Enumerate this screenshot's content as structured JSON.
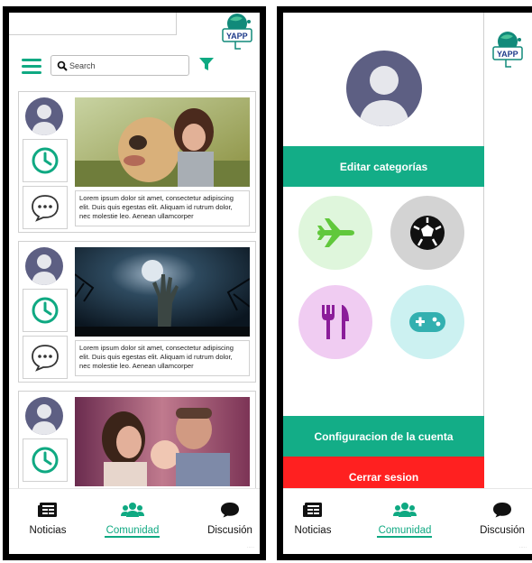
{
  "colors": {
    "accent": "#0fa982",
    "drawer_green": "#13ad87",
    "danger": "#ff2020",
    "avatar_bg": "#5d5f83"
  },
  "left_screen": {
    "search": {
      "placeholder": "Search"
    },
    "posts": [
      {
        "caption": "Lorem ipsum dolor sit amet, consectetur adipiscing elit. Duis quis egestas elit. Aliquam id rutrum dolor, nec molestie leo. Aenean ullamcorper"
      },
      {
        "caption": "Lorem ipsum dolor sit amet, consectetur adipiscing elit. Duis quis egestas elit. Aliquam id rutrum dolor, nec molestie leo. Aenean ullamcorper"
      },
      {
        "caption": ""
      }
    ]
  },
  "right_screen": {
    "edit_categories": "Editar categorías",
    "categories": [
      {
        "icon": "airplane-icon",
        "bg": "#dff6dc"
      },
      {
        "icon": "soccer-ball-icon",
        "bg": "#d3d3d3"
      },
      {
        "icon": "fork-knife-icon",
        "bg": "#f0ccf2"
      },
      {
        "icon": "gamepad-icon",
        "bg": "#ccf1f1"
      }
    ],
    "account_settings": "Configuracion de la cuenta",
    "logout": "Cerrar sesion"
  },
  "nav": {
    "items": [
      {
        "label": "Noticias",
        "icon": "newspaper-icon"
      },
      {
        "label": "Comunidad",
        "icon": "group-icon"
      },
      {
        "label": "Discusión",
        "icon": "chat-bubble-icon"
      }
    ],
    "active": 1
  }
}
